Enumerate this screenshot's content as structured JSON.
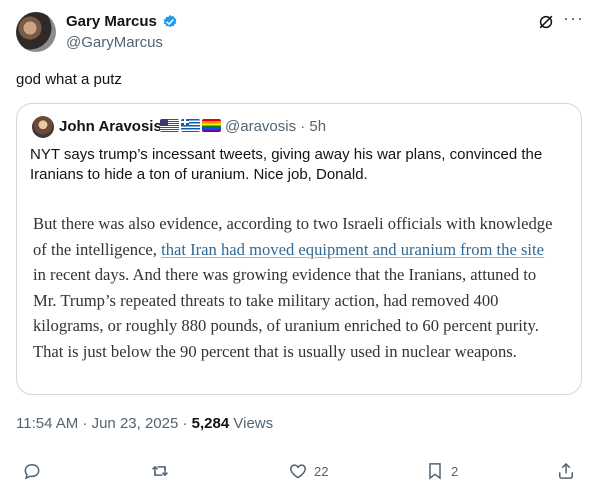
{
  "author": {
    "name": "Gary Marcus",
    "handle": "@GaryMarcus",
    "verified": true
  },
  "tweet": {
    "text": "god what a putz"
  },
  "quoted": {
    "name": "John Aravosis",
    "flags": [
      "us-flag",
      "greece-flag",
      "rainbow-flag"
    ],
    "handle_time": "@aravosis · 5h",
    "text": "NYT says trump’s incessant tweets, giving away his war plans, convinced the Iranians to hide a ton of uranium. Nice job, Donald.",
    "article": {
      "before": "But there was also evidence, according to two Israeli officials with knowledge of the intelligence, ",
      "link": "that Iran had moved equipment and uranium from the site",
      "after": " in recent days. And there was growing evidence that the Iranians, attuned to Mr. Trump’s repeated threats to take military action, had removed 400 kilograms, or roughly 880 pounds, of uranium enriched to 60 percent purity. That is just below the 90 percent that is usually used in nuclear weapons."
    }
  },
  "meta": {
    "datetime": "11:54 AM · Jun 23, 2025 · ",
    "views_count": "5,284",
    "views_label": " Views"
  },
  "actions": {
    "reply_count": "",
    "retweet_count": "",
    "like_count": "22",
    "bookmark_count": "2"
  },
  "colors": {
    "verified": "#1d9bf0",
    "link": "#326891",
    "muted": "#536471"
  }
}
